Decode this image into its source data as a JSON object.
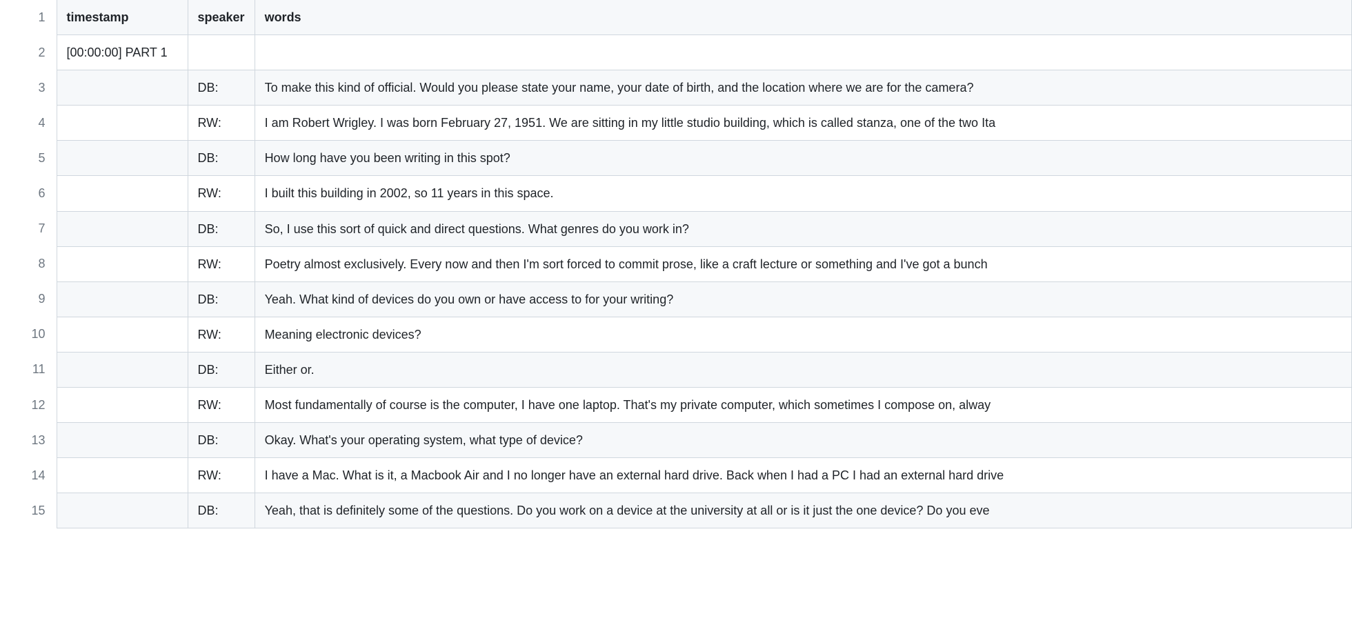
{
  "columns": [
    "timestamp",
    "speaker",
    "words"
  ],
  "rows": [
    {
      "n": 1,
      "timestamp": "timestamp",
      "speaker": "speaker",
      "words": "words",
      "header": true
    },
    {
      "n": 2,
      "timestamp": "[00:00:00] PART 1",
      "speaker": "",
      "words": ""
    },
    {
      "n": 3,
      "timestamp": "",
      "speaker": "DB:",
      "words": "To make this kind of official. Would you please state your name, your date of birth, and the location where we are for the camera?"
    },
    {
      "n": 4,
      "timestamp": "",
      "speaker": "RW:",
      "words": "I am Robert Wrigley. I was born February 27, 1951. We are sitting in my little studio building, which is called stanza, one of the two Ita"
    },
    {
      "n": 5,
      "timestamp": "",
      "speaker": "DB:",
      "words": "How long have you been writing in this spot?"
    },
    {
      "n": 6,
      "timestamp": "",
      "speaker": "RW:",
      "words": "I built this building in 2002, so 11 years in this space."
    },
    {
      "n": 7,
      "timestamp": "",
      "speaker": "DB:",
      "words": "So, I use this sort of quick and direct questions. What genres do you work in?"
    },
    {
      "n": 8,
      "timestamp": "",
      "speaker": "RW:",
      "words": "Poetry almost exclusively. Every now and then I'm sort forced to commit prose, like a craft lecture or something and I've got a bunch"
    },
    {
      "n": 9,
      "timestamp": "",
      "speaker": "DB:",
      "words": "Yeah. What kind of devices do you own or have access to for your writing?"
    },
    {
      "n": 10,
      "timestamp": "",
      "speaker": "RW:",
      "words": "Meaning electronic devices?"
    },
    {
      "n": 11,
      "timestamp": "",
      "speaker": "DB:",
      "words": "Either or."
    },
    {
      "n": 12,
      "timestamp": "",
      "speaker": "RW:",
      "words": "Most fundamentally of course is the computer, I have one laptop. That's my private computer, which sometimes I compose on, alway"
    },
    {
      "n": 13,
      "timestamp": "",
      "speaker": "DB:",
      "words": "Okay. What's your operating system, what type of device?"
    },
    {
      "n": 14,
      "timestamp": "",
      "speaker": "RW:",
      "words": "I have a Mac. What is it, a Macbook Air and I no longer have an external hard drive. Back when I had a PC I had an external hard drive"
    },
    {
      "n": 15,
      "timestamp": "",
      "speaker": "DB:",
      "words": "Yeah, that is definitely some of the questions. Do you work on a device at the university at all or is it just the one device? Do you eve"
    }
  ]
}
